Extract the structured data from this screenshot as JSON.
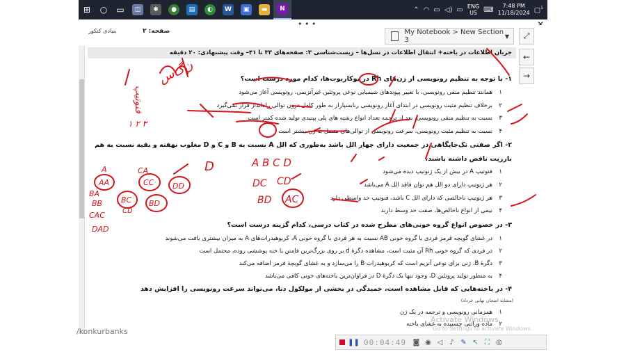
{
  "taskbar": {
    "lang_top": "ENG",
    "lang_bottom": "US",
    "time": "7:48 PM",
    "date": "11/18/2024",
    "notification_count": "1"
  },
  "onenote": {
    "breadcrumb": "My Notebook > New Section 3",
    "more_dots": "• • •",
    "page_label": "صفحه: ۲",
    "logo_text": "بنیادی کنکور"
  },
  "document": {
    "title": "جریان اطلاعات در یاخته+ انتقال اطلاعات در نسل‌ها – زیست‌شناسی ۳: صفحه‌های ۳۳ تا ۴۱– وقت پیشنهادی: ۲۰ دقیقه",
    "q1": "۱- با توجه به تنظیم رونویسی از ژن‌های Rh در یوکاریوت‌ها، کدام مورد درست است؟",
    "q1_opts": [
      "همانند تنظیم منفی رونویسی، با تغییر پیوندهای شیمیایی نوعی پروتئین غیرآنزیمی، رونویسی آغاز می‌شود",
      "برخلاف تنظیم مثبت رونویسی در ابتدای آغاز رونویسی رنابسپاراز به طور کامل درون توالی راه‌انداز قرار نمی‌گیرد",
      "نسبت به تنظیم منفی رونویسی، بعد از ترجمه تعداد انواع رشته های پلی پپتیدی تولید شده کمتر است",
      "نسبت به تنظیم مثبت رونویسی، سرعت رونویسی از توالی‌های متصل به ژن بیشتر است"
    ],
    "q2": "۲- اگر صفتی تک‌جایگاهی در جمعیت دارای چهار الل باشد به‌طوری که الل A نسبت به B و C و D مغلوب نهفته و بقیه نسبت به هم",
    "q2_cont": "بارزیت ناقص داشته باشند،",
    "q2_opts": [
      "فنوتیپ A در بیش از یک ژنوتیپ دیده می‌شود",
      "هر ژنوتیپ دارای دو الل هم توان فاقد الل A می‌باشد",
      "هر ژنوتیپ ناخالصی که دارای الل C باشد، فنوتیپ حد واسطی دارد",
      "نیمی از انواع ناخالص‌ها، صفت حد وسط دارند"
    ],
    "q3": "۳- در خصوص انواع گروه خونی‌های مطرح شده در کتاب درسی، کدام گزینه درست است؟",
    "q3_opts": [
      "در غشای گویچه قرمز فردی با گروه خونی AB نسبت به هر فردی با گروه خونی A، کربوهیدرات‌های A به میزان بیشتری یافت می‌شوند",
      "در فردی که گروه خونی Rh آن مثبت است، مشاهده دگرهٔ d بر روی بزرگ‌ترین فامتن یا خته پوششی روده، محتمل است",
      "دگرهٔ B، ژنی برای نوعی آنزیم است که کربوهیدرات B را می‌سازد و به غشای گویچهٔ قرمز اضافه می‌کند",
      "به منظور تولید پروتئین D، وجود تنها یک دگرهٔ D در فراوان‌ترین یاخته‌های خونی کافی می‌باشد"
    ],
    "q4": "۴- در یاخته‌هایی که             قابل مشاهده است، خمیدگی در بخشی از مولکول دنا، می‌تواند سرعت رونویسی را افزایش دهد",
    "q4_opts": [
      "همزمانی رونویسی و ترجمه در یک ژن",
      "ماده وراثتی چسبیده به غشای یاخته"
    ],
    "note": "(مشابه امتحان نهایی خرداد)"
  },
  "watermark": "/konkurbanks",
  "activate_windows": "Activate Windows",
  "activate_windows_sub": "Go to Settings to activate Windows.",
  "recorder": {
    "time": "00:04:49"
  },
  "handwriting": {
    "top_note": "ن‌گ‌س",
    "left_1": "فنوتیپ",
    "left_2": "۱ ۲ ۳",
    "letters_row": "A B C D",
    "left_letters": [
      "A",
      "AA",
      "CA",
      "CC",
      "DD",
      "BA",
      "BB",
      "BC",
      "BD",
      "CD",
      "CAC",
      "DAD",
      "D"
    ],
    "mid_letters": [
      "DC",
      "CD",
      "BD",
      "AC"
    ]
  }
}
